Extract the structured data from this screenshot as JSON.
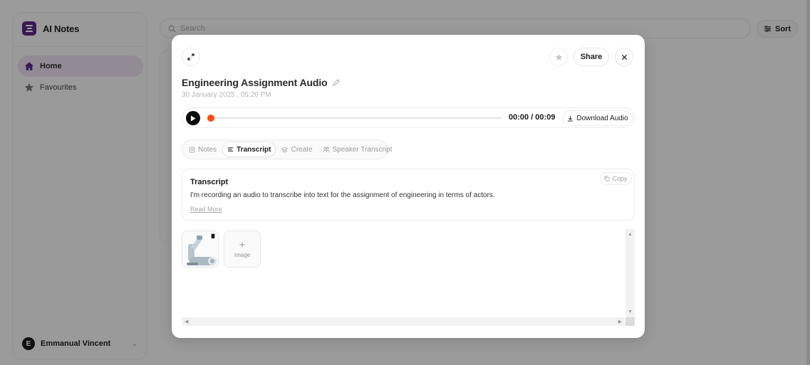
{
  "app": {
    "name": "AI Notes",
    "brand_color": "#5b2a86"
  },
  "sidebar": {
    "items": [
      {
        "label": "Home",
        "icon": "home-icon",
        "active": true
      },
      {
        "label": "Favourites",
        "icon": "star-icon",
        "active": false
      }
    ],
    "user": {
      "initial": "E",
      "name": "Emmanual Vincent"
    }
  },
  "header": {
    "search_placeholder": "Search",
    "sort_label": "Sort"
  },
  "modal": {
    "share_label": "Share",
    "title": "Engineering Assignment Audio",
    "date": "30 January 2025 , 05:26 PM",
    "player": {
      "time": "00:00 / 00:09",
      "progress": 0,
      "accent_color": "#ff4d12",
      "download_label": "Download Audio"
    },
    "tabs": [
      {
        "label": "Notes",
        "icon": "notes-icon",
        "active": false
      },
      {
        "label": "Transcript",
        "icon": "transcript-icon",
        "active": true
      },
      {
        "label": "Create",
        "icon": "create-icon",
        "active": false
      },
      {
        "label": "Speaker Transcript",
        "icon": "speakers-icon",
        "active": false
      }
    ],
    "transcript": {
      "heading": "Transcript",
      "copy_label": "Copy",
      "text": "I'm recording an audio to transcribe into text for the assignment of engineering in terms of actors.",
      "read_more": "Read More"
    },
    "media": {
      "add_label": "Image",
      "add_symbol": "+"
    }
  }
}
